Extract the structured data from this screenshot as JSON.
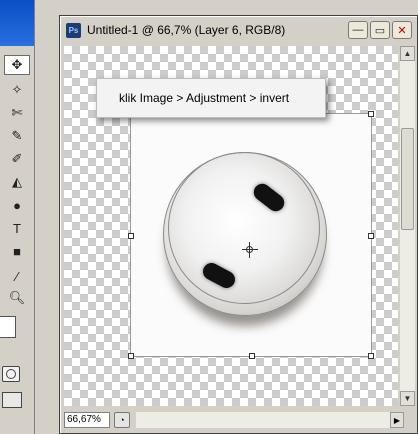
{
  "document": {
    "title": "Untitled-1 @ 66,7% (Layer 6, RGB/8)",
    "app_icon_text": "Ps"
  },
  "window_controls": {
    "minimize": "—",
    "maximize": "▭",
    "close": "✕"
  },
  "instruction": {
    "text": "klik Image > Adjustment > invert"
  },
  "status": {
    "zoom": "66,67%"
  },
  "toolbox": {
    "tools": [
      "move-tool",
      "magic-wand-tool",
      "healing-tool",
      "brush-tool",
      "history-brush-tool",
      "eraser-tool",
      "paint-bucket-tool",
      "dodge-tool",
      "path-selection-tool",
      "text-tool",
      "pen-tool",
      "shape-tool",
      "eyedropper-tool",
      "hand-tool",
      "zoom-tool"
    ]
  },
  "colors": {
    "window_bg": "#d4d0c8",
    "titlebar_blue": "#0a4fc4",
    "canvas_fill": "#fbfbfb",
    "checker": "#cccccc"
  }
}
